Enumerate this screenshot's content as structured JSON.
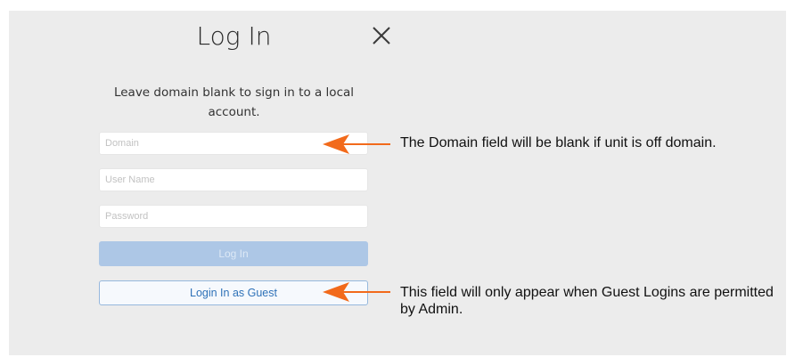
{
  "dialog": {
    "title": "Log In",
    "subtitle": "Leave domain blank to sign in to a local account.",
    "close_icon": "close-icon"
  },
  "form": {
    "domain_placeholder": "Domain",
    "domain_value": "",
    "username_placeholder": "User Name",
    "username_value": "",
    "password_placeholder": "Password",
    "password_value": "",
    "login_button_label": "Log In",
    "guest_button_label": "Login In as Guest"
  },
  "annotations": {
    "domain_note": "The Domain field will be blank if unit is off domain.",
    "guest_note": "This field will only appear when Guest Logins are permitted by Admin.",
    "arrow_color": "#f26a1b"
  },
  "colors": {
    "login_button_bg": "#adc7e6",
    "guest_button_border": "#96b8dd",
    "guest_button_text": "#2f72b8"
  }
}
